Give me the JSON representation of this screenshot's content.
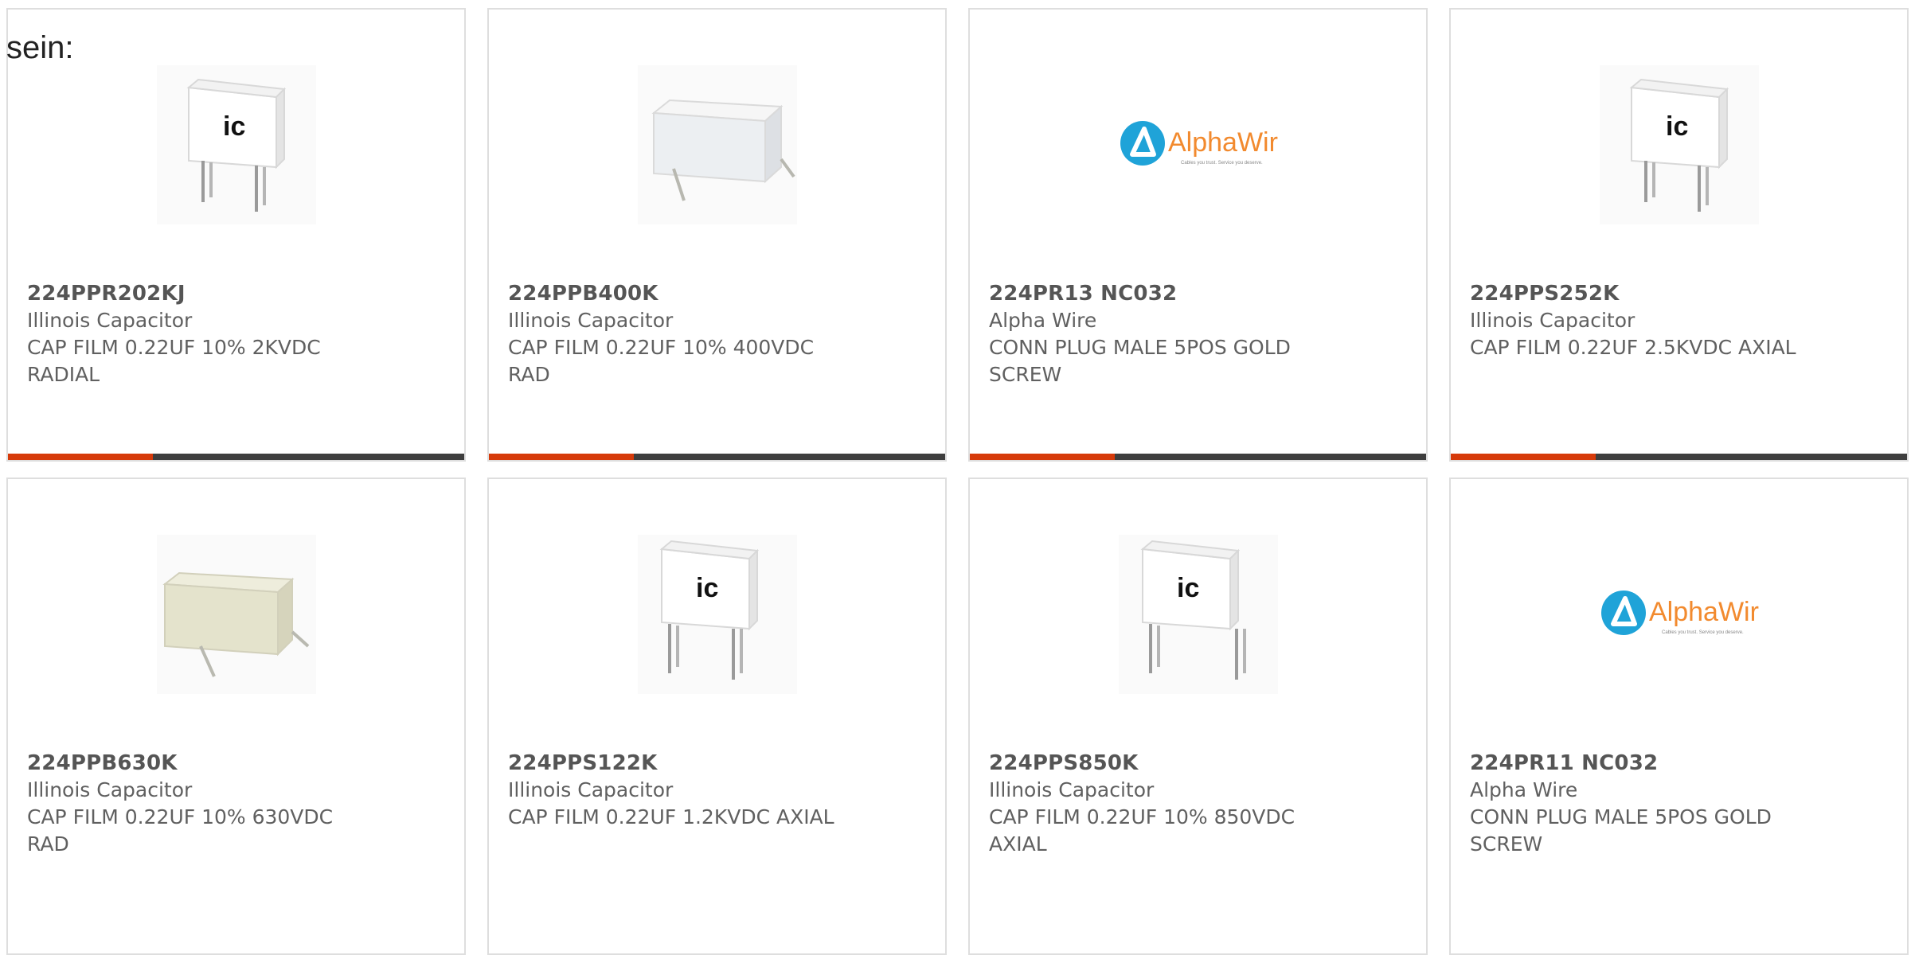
{
  "overlay_text": "sein:",
  "colors": {
    "accent": "#d63a0a",
    "bar_dark": "#3e3e3e",
    "card_border": "#dedede",
    "text": "#555555"
  },
  "products": [
    {
      "mpn": "224PPR202KJ",
      "manufacturer": "Illinois Capacitor",
      "desc1": "CAP FILM 0.22UF 10% 2KVDC",
      "desc2": "RADIAL",
      "image": "capacitor-ic-radial-icon"
    },
    {
      "mpn": "224PPB400K",
      "manufacturer": "Illinois Capacitor",
      "desc1": "CAP FILM 0.22UF 10% 400VDC",
      "desc2": "RAD",
      "image": "capacitor-white-box-icon"
    },
    {
      "mpn": "224PR13 NC032",
      "manufacturer": "Alpha Wire",
      "desc1": "CONN PLUG MALE 5POS GOLD",
      "desc2": "SCREW",
      "image": "alphawire-logo",
      "logo_text": "AlphaWire",
      "logo_tagline": "Cables you trust. Service you deserve."
    },
    {
      "mpn": "224PPS252K",
      "manufacturer": "Illinois Capacitor",
      "desc1": "CAP FILM 0.22UF 2.5KVDC AXIAL",
      "desc2": "",
      "image": "capacitor-ic-radial-icon"
    },
    {
      "mpn": "224PPB630K",
      "manufacturer": "Illinois Capacitor",
      "desc1": "CAP FILM 0.22UF 10% 630VDC",
      "desc2": "RAD",
      "image": "capacitor-beige-box-icon"
    },
    {
      "mpn": "224PPS122K",
      "manufacturer": "Illinois Capacitor",
      "desc1": "CAP FILM 0.22UF 1.2KVDC AXIAL",
      "desc2": "",
      "image": "capacitor-ic-radial-icon"
    },
    {
      "mpn": "224PPS850K",
      "manufacturer": "Illinois Capacitor",
      "desc1": "CAP FILM 0.22UF 10% 850VDC",
      "desc2": "AXIAL",
      "image": "capacitor-ic-radial-icon"
    },
    {
      "mpn": "224PR11 NC032",
      "manufacturer": "Alpha Wire",
      "desc1": "CONN PLUG MALE 5POS GOLD",
      "desc2": "SCREW",
      "image": "alphawire-logo",
      "logo_text": "AlphaWire",
      "logo_tagline": "Cables you trust. Service you deserve."
    }
  ]
}
